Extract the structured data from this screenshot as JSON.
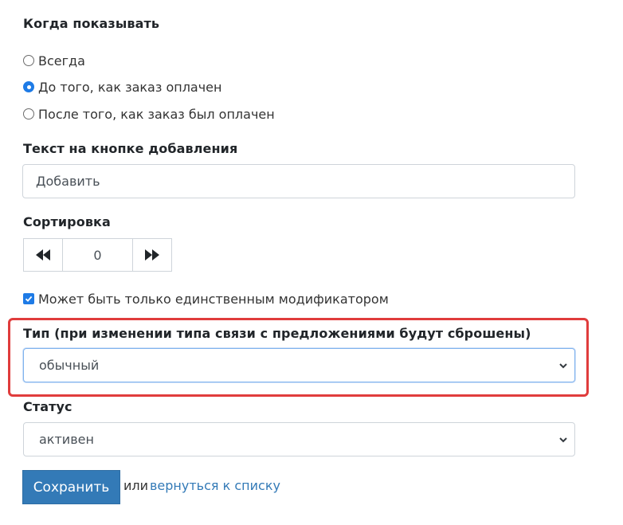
{
  "show_when": {
    "label": "Когда показывать",
    "options": [
      {
        "label": "Всегда",
        "checked": false
      },
      {
        "label": "До того, как заказ оплачен",
        "checked": true
      },
      {
        "label": "После того, как заказ был оплачен",
        "checked": false
      }
    ]
  },
  "add_button_text": {
    "label": "Текст на кнопке добавления",
    "value": "Добавить"
  },
  "sorting": {
    "label": "Сортировка",
    "value": "0",
    "decrement_icon": "fast-backward-icon",
    "increment_icon": "fast-forward-icon"
  },
  "single_modifier": {
    "label": "Может быть только единственным модификатором",
    "checked": true
  },
  "type": {
    "label": "Тип (при изменении типа связи с предложениями будут сброшены)",
    "selected": "обычный",
    "highlight_color": "#e03c3c"
  },
  "status": {
    "label": "Статус",
    "selected": "активен"
  },
  "actions": {
    "save_label": "Сохранить",
    "or_text": "или",
    "back_link": "вернуться к списку"
  },
  "colors": {
    "accent": "#1e7be6",
    "button": "#337ab7"
  }
}
